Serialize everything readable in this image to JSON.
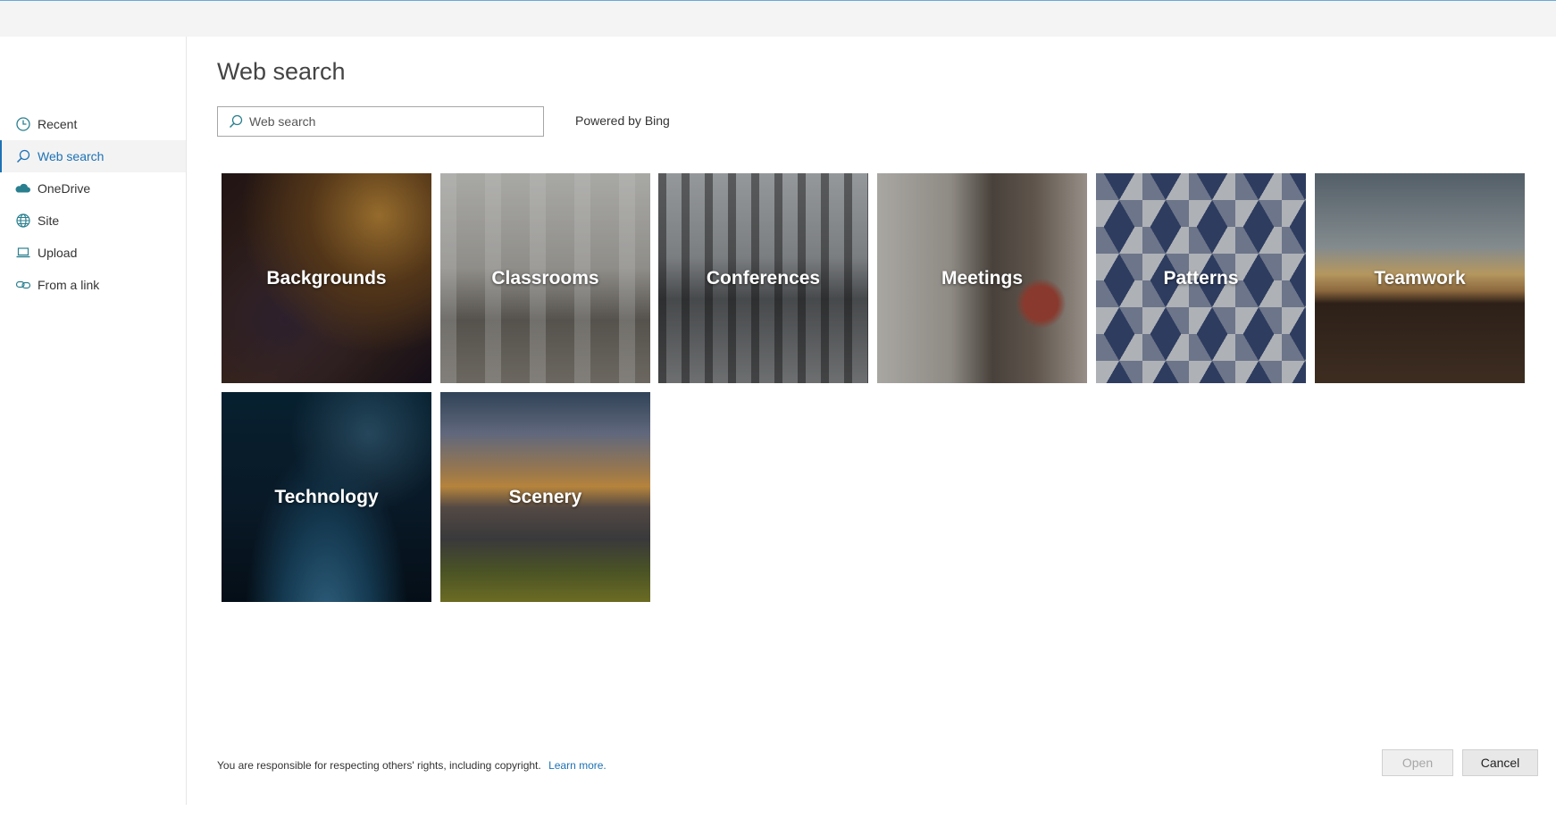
{
  "sidebar": {
    "items": [
      {
        "label": "Recent",
        "icon": "clock-icon",
        "active": false
      },
      {
        "label": "Web search",
        "icon": "search-icon",
        "active": true
      },
      {
        "label": "OneDrive",
        "icon": "cloud-icon",
        "active": false
      },
      {
        "label": "Site",
        "icon": "globe-icon",
        "active": false
      },
      {
        "label": "Upload",
        "icon": "laptop-icon",
        "active": false
      },
      {
        "label": "From a link",
        "icon": "link-icon",
        "active": false
      }
    ]
  },
  "main": {
    "title": "Web search",
    "search": {
      "placeholder": "Web search",
      "value": ""
    },
    "powered_by": "Powered by Bing",
    "tiles": [
      {
        "label": "Backgrounds"
      },
      {
        "label": "Classrooms"
      },
      {
        "label": "Conferences"
      },
      {
        "label": "Meetings"
      },
      {
        "label": "Patterns"
      },
      {
        "label": "Teamwork"
      },
      {
        "label": "Technology"
      },
      {
        "label": "Scenery"
      }
    ],
    "footer_note": "You are responsible for respecting others' rights, including copyright.",
    "learn_more": "Learn more."
  },
  "buttons": {
    "open": "Open",
    "cancel": "Cancel"
  },
  "colors": {
    "accent": "#1d72b5",
    "icon": "#2a7f8f"
  }
}
